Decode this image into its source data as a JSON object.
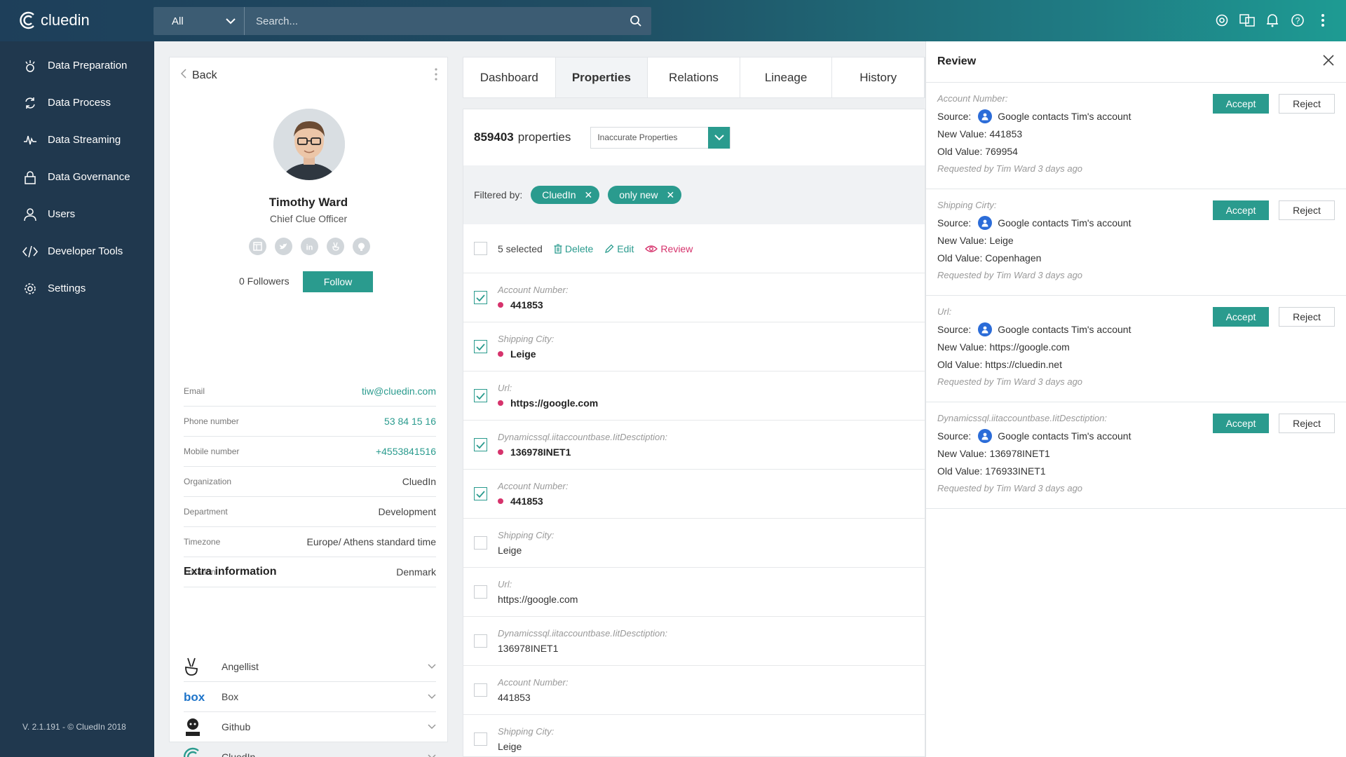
{
  "app": {
    "logo_text": "cluedin"
  },
  "search": {
    "scope": "All",
    "placeholder": "Search..."
  },
  "sidebar": {
    "items": [
      {
        "label": "Data Preparation",
        "icon": "data-preparation-icon"
      },
      {
        "label": "Data Process",
        "icon": "data-process-icon"
      },
      {
        "label": "Data Streaming",
        "icon": "data-streaming-icon"
      },
      {
        "label": "Data Governance",
        "icon": "lock-icon"
      },
      {
        "label": "Users",
        "icon": "user-icon"
      },
      {
        "label": "Developer Tools",
        "icon": "code-icon"
      },
      {
        "label": "Settings",
        "icon": "gear-icon"
      }
    ],
    "version": "V. 2.1.191 - © CluedIn  2018"
  },
  "profile": {
    "back": "Back",
    "name": "Timothy Ward",
    "title": "Chief Clue Officer",
    "followers": "0 Followers",
    "follow": "Follow",
    "fields": [
      {
        "label": "Email",
        "value": "tiw@cluedin.com",
        "link": true
      },
      {
        "label": "Phone number",
        "value": "53 84 15 16",
        "link": true
      },
      {
        "label": "Mobile number",
        "value": "+4553841516",
        "link": true
      },
      {
        "label": "Organization",
        "value": "CluedIn",
        "link": false
      },
      {
        "label": "Department",
        "value": "Development",
        "link": false
      },
      {
        "label": "Timezone",
        "value": "Europe/ Athens standard time",
        "link": false
      },
      {
        "label": "Location",
        "value": "Denmark",
        "link": false
      }
    ],
    "extra_title": "Extra information",
    "extras": [
      {
        "label": "Angellist"
      },
      {
        "label": "Box"
      },
      {
        "label": "Github"
      },
      {
        "label": "CluedIn"
      }
    ]
  },
  "tabs": [
    "Dashboard",
    "Properties",
    "Relations",
    "Lineage",
    "History"
  ],
  "properties": {
    "count": "859403",
    "count_word": "properties",
    "filter_select": "Inaccurate Properties",
    "filtered_by": "Filtered by:",
    "chips": [
      "CluedIn",
      "only new"
    ],
    "selected": "5 selected",
    "delete": "Delete",
    "edit": "Edit",
    "review": "Review",
    "rows": [
      {
        "label": "Account Number:",
        "value": "441853",
        "checked": true
      },
      {
        "label": "Shipping City:",
        "value": "Leige",
        "checked": true
      },
      {
        "label": "Url:",
        "value": "https://google.com",
        "checked": true
      },
      {
        "label": "Dynamicssql.iitaccountbase.IitDesctiption:",
        "value": "136978INET1",
        "checked": true
      },
      {
        "label": "Account Number:",
        "value": "441853",
        "checked": true
      },
      {
        "label": "Shipping City:",
        "value": "Leige",
        "checked": false
      },
      {
        "label": "Url:",
        "value": "https://google.com",
        "checked": false
      },
      {
        "label": "Dynamicssql.iitaccountbase.IitDesctiption:",
        "value": "136978INET1",
        "checked": false
      },
      {
        "label": "Account Number:",
        "value": "441853",
        "checked": false
      },
      {
        "label": "Shipping City:",
        "value": "Leige",
        "checked": false
      }
    ]
  },
  "review": {
    "title": "Review",
    "accept": "Accept",
    "reject": "Reject",
    "cards": [
      {
        "label": "Account Number:",
        "source_label": "Source:",
        "source": "Google contacts Tim's account",
        "new_value": "New Value: 441853",
        "old_value": "Old Value: 769954",
        "requested": "Requested by Tim Ward 3 days ago"
      },
      {
        "label": "Shipping Cirty:",
        "source_label": "Source:",
        "source": "Google contacts Tim's account",
        "new_value": "New Value: Leige",
        "old_value": "Old Value: Copenhagen",
        "requested": "Requested by Tim Ward 3 days ago"
      },
      {
        "label": "Url:",
        "source_label": "Source:",
        "source": "Google contacts Tim's account",
        "new_value": "New Value: https://google.com",
        "old_value": "Old Value: https://cluedin.net",
        "requested": "Requested by Tim Ward 3 days ago"
      },
      {
        "label": "Dynamicssql.iitaccountbase.IitDesctiption:",
        "source_label": "Source:",
        "source": "Google contacts Tim's account",
        "new_value": "New Value: 136978INET1",
        "old_value": "Old Value: 176933INET1",
        "requested": "Requested by Tim Ward 3 days ago"
      }
    ]
  },
  "colors": {
    "accent": "#2a9b8e",
    "sidebar": "#20384e",
    "danger": "#d6336c"
  }
}
